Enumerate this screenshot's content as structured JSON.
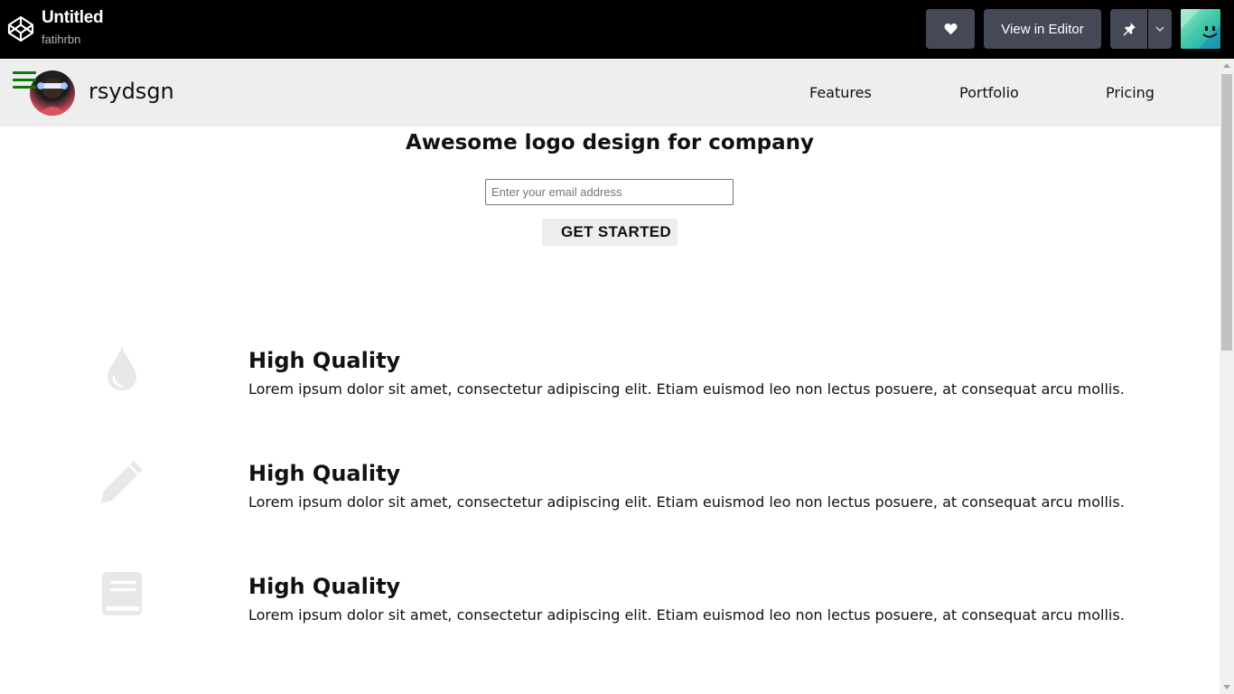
{
  "codepen": {
    "title": "Untitled",
    "user": "fatihrbn",
    "view_in_editor": "View in Editor",
    "icons": {
      "logo": "codepen-logo-icon",
      "heart": "heart-icon",
      "pin": "pin-icon",
      "caret": "chevron-down-icon"
    }
  },
  "header": {
    "brand": "rsydsgn",
    "nav": [
      "Features",
      "Portfolio",
      "Pricing"
    ]
  },
  "hero": {
    "title": "Awesome logo design for company",
    "email_placeholder": "Enter your email address",
    "cta": "GET STARTED"
  },
  "features": [
    {
      "icon": "droplet-icon",
      "heading": "High Quality",
      "text": "Lorem ipsum dolor sit amet, consectetur adipiscing elit. Etiam euismod leo non lectus posuere, at consequat arcu mollis."
    },
    {
      "icon": "pencil-icon",
      "heading": "High Quality",
      "text": "Lorem ipsum dolor sit amet, consectetur adipiscing elit. Etiam euismod leo non lectus posuere, at consequat arcu mollis."
    },
    {
      "icon": "book-icon",
      "heading": "High Quality",
      "text": "Lorem ipsum dolor sit amet, consectetur adipiscing elit. Etiam euismod leo non lectus posuere, at consequat arcu mollis."
    }
  ],
  "colors": {
    "accent_green": "#0b7a0b",
    "icon_gray": "#e6e6e6",
    "header_bg": "#eeeeee"
  }
}
